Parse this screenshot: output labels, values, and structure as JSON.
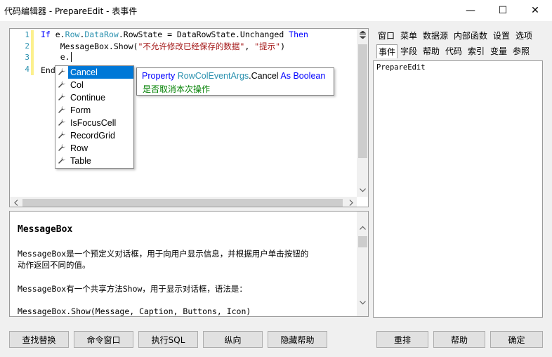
{
  "window": {
    "title": "代码编辑器 - PrepareEdit - 表事件",
    "minimize_glyph": "—",
    "maximize_glyph": "☐",
    "close_glyph": "✕"
  },
  "editor": {
    "line_numbers": [
      "1",
      "2",
      "3",
      "4"
    ],
    "line1": {
      "kw_if": "If",
      "e": "e.",
      "row": "Row",
      "dot1": ".",
      "datarow": "DataRow",
      "rest": ".RowState = DataRowState.Unchanged ",
      "kw_then": "Then"
    },
    "line2": {
      "pre": "    MessageBox.Show(",
      "arg1": "\"不允许修改已经保存的数据\"",
      "comma": ", ",
      "arg2": "\"提示\"",
      "post": ")"
    },
    "line3": {
      "text": "    e."
    },
    "line4": {
      "text": "End"
    }
  },
  "autocomplete": {
    "items": [
      "Cancel",
      "Col",
      "Continue",
      "Form",
      "IsFocusCell",
      "RecordGrid",
      "Row",
      "Table"
    ],
    "selected": "Cancel",
    "item_icon": "wrench-icon"
  },
  "tooltip": {
    "kind": "Property",
    "class_name": "RowColEventArgs",
    "member": ".Cancel",
    "as": "As",
    "type": "Boolean",
    "description": "是否取消本次操作"
  },
  "help": {
    "title": "MessageBox",
    "para1_line1": "MessageBox是一个预定义对话框，用于向用户显示信息，并根据用户单击按钮的",
    "para1_line2": "动作返回不同的值。",
    "para2": "MessageBox有一个共享方法Show，用于显示对话框，语法是：",
    "para3": "MessageBox.Show(Message, Caption, Buttons, Icon)"
  },
  "right_panel": {
    "tabs_row1": [
      "窗口",
      "菜单",
      "数据源",
      "内部函数",
      "设置",
      "选项"
    ],
    "tabs_row2": [
      "事件",
      "字段",
      "帮助",
      "代码",
      "索引",
      "变量",
      "参照"
    ],
    "active_tab": "事件",
    "list_items": [
      "PrepareEdit"
    ]
  },
  "buttons": {
    "find_replace": "查找替换",
    "command_window": "命令窗口",
    "execute_sql": "执行SQL",
    "vertical": "纵向",
    "hide_help": "隐藏帮助",
    "rearrange": "重排",
    "help": "帮助",
    "ok": "确定"
  },
  "colors": {
    "keyword": "#0000ff",
    "type": "#2b91af",
    "string": "#a31515",
    "selection": "#0078d7",
    "tooltip_desc": "#008000"
  }
}
